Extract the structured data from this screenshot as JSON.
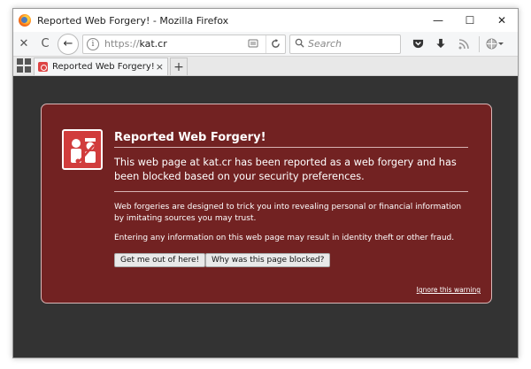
{
  "window": {
    "title": "Reported Web Forgery! - Mozilla Firefox",
    "controls": {
      "minimize": "—",
      "maximize": "☐",
      "close": "✕"
    }
  },
  "navbar": {
    "stop_icon": "✕",
    "reload_icon": "C",
    "back_icon": "←",
    "url_scheme": "https://",
    "url_host": "kat.cr",
    "search_placeholder": "Search"
  },
  "tabs": [
    {
      "label": "Reported Web Forgery!",
      "close": "×"
    }
  ],
  "newtab_label": "+",
  "warning": {
    "title": "Reported Web Forgery!",
    "lead": "This web page at kat.cr has been reported as a web forgery and has been blocked based on your security preferences.",
    "body1": "Web forgeries are designed to trick you into revealing personal or financial information by imitating sources you may trust.",
    "body2": "Entering any information on this web page may result in identity theft or other fraud.",
    "btn_getout": "Get me out of here!",
    "btn_why": "Why was this page blocked?",
    "ignore": "Ignore this warning"
  },
  "colors": {
    "panel_bg": "#722222",
    "page_bg": "#333333",
    "badge_bg": "#d13c3c"
  },
  "icons": {
    "app": "firefox-icon",
    "badge": "forgery-officer-icon",
    "pocket": "pocket-icon",
    "download": "download-icon",
    "rss": "rss-icon",
    "menu": "globe-menu-icon"
  }
}
